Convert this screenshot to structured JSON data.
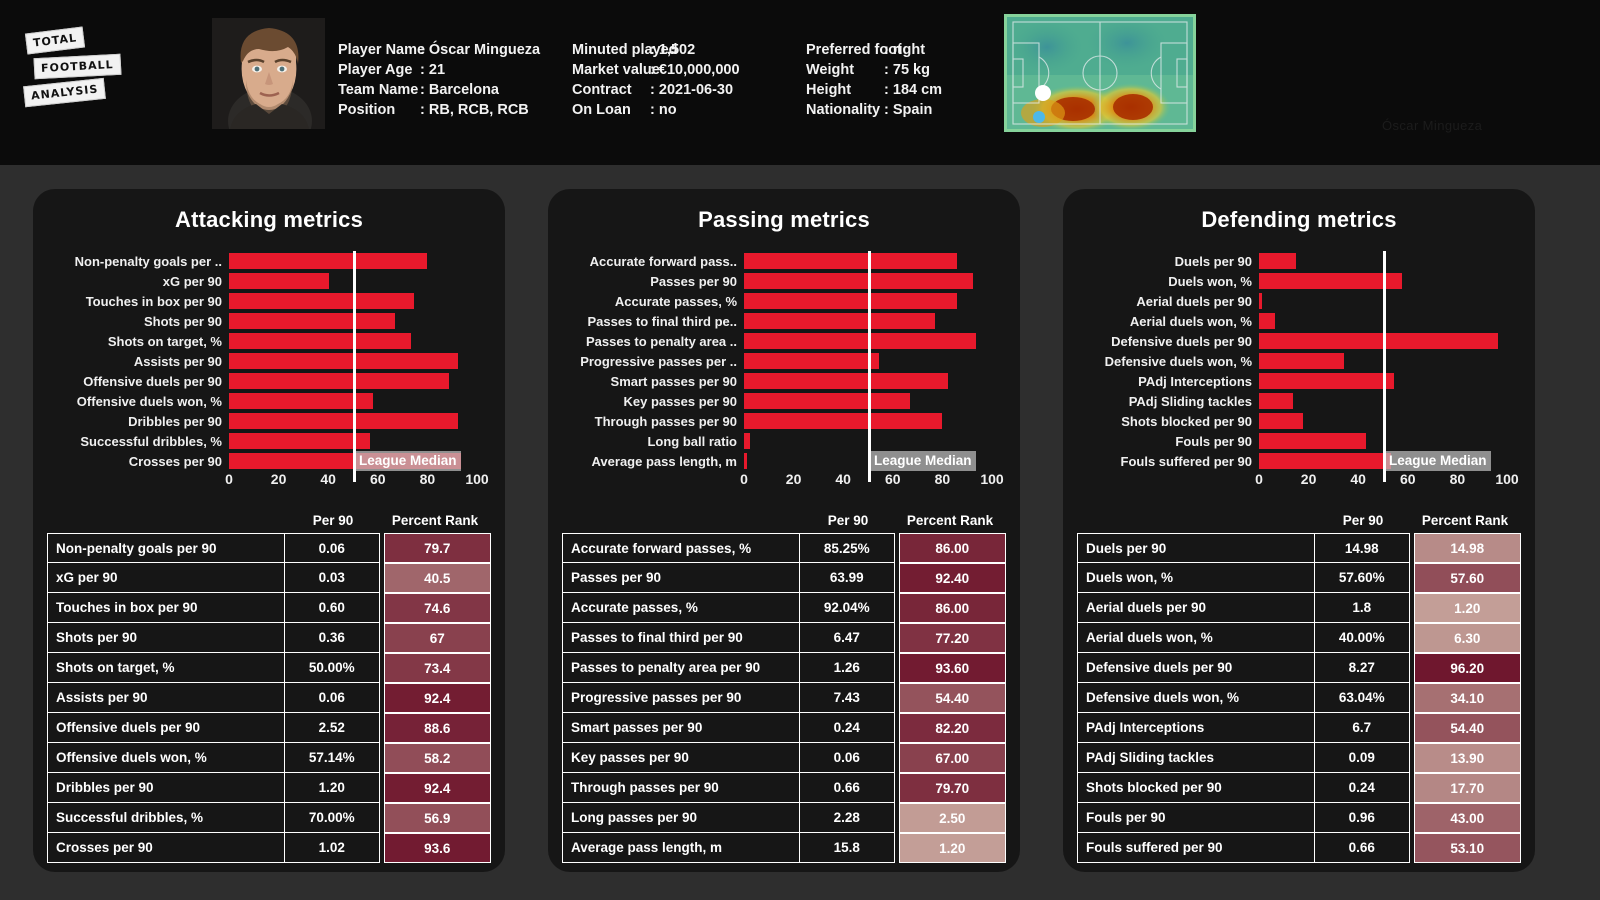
{
  "brand": {
    "line1": "TOTAL",
    "line2": "FOOTBALL",
    "line3": "ANALYSIS"
  },
  "watermark": "Óscar Mingueza",
  "player": {
    "fields_col1": [
      {
        "key": "Player Name",
        "sep": ":",
        "value": "Óscar Mingueza"
      },
      {
        "key": "Player Age",
        "sep": ":",
        "value": "21"
      },
      {
        "key": "Team Name",
        "sep": ":",
        "value": "Barcelona"
      },
      {
        "key": "Position",
        "sep": ":",
        "value": "RB, RCB, RCB"
      }
    ],
    "fields_col2": [
      {
        "key": "Minuted played",
        "sep": ":",
        "value": "1,502"
      },
      {
        "key": "Market value",
        "sep": ":",
        "value": "€10,000,000"
      },
      {
        "key": "Contract",
        "sep": ":",
        "value": "2021-06-30"
      },
      {
        "key": "On Loan",
        "sep": ":",
        "value": "no"
      }
    ],
    "fields_col3": [
      {
        "key": "Preferred foot",
        "sep": ":",
        "value": "right"
      },
      {
        "key": "Weight",
        "sep": ":",
        "value": "75 kg"
      },
      {
        "key": "Height",
        "sep": ":",
        "value": "184 cm"
      },
      {
        "key": "Nationality",
        "sep": ":",
        "value": "Spain"
      }
    ]
  },
  "axis_ticks": [
    "0",
    "20",
    "40",
    "60",
    "80",
    "100"
  ],
  "median_label": "League Median",
  "table_headers": {
    "metric": "",
    "per90": "Per 90",
    "rank": "Percent Rank"
  },
  "accent_bar": "#e8192c",
  "panels": [
    {
      "title": "Attacking metrics",
      "chart_labels": [
        "Non-penalty goals per ..",
        "xG per 90",
        "Touches in box per 90",
        "Shots per 90",
        "Shots on target, %",
        "Assists per 90",
        "Offensive duels per 90",
        "Offensive duels won, %",
        "Dribbles per 90",
        "Successful dribbles, %",
        "Crosses per 90"
      ],
      "rows": [
        {
          "metric": "Non-penalty goals per 90",
          "per90": "0.06",
          "rank": "79.7",
          "rank_value": 79.7
        },
        {
          "metric": "xG per 90",
          "per90": "0.03",
          "rank": "40.5",
          "rank_value": 40.5
        },
        {
          "metric": "Touches in box per 90",
          "per90": "0.60",
          "rank": "74.6",
          "rank_value": 74.6
        },
        {
          "metric": "Shots per 90",
          "per90": "0.36",
          "rank": "67",
          "rank_value": 67.0
        },
        {
          "metric": "Shots on target, %",
          "per90": "50.00%",
          "rank": "73.4",
          "rank_value": 73.4
        },
        {
          "metric": "Assists per 90",
          "per90": "0.06",
          "rank": "92.4",
          "rank_value": 92.4
        },
        {
          "metric": "Offensive duels per 90",
          "per90": "2.52",
          "rank": "88.6",
          "rank_value": 88.6
        },
        {
          "metric": "Offensive duels won, %",
          "per90": "57.14%",
          "rank": "58.2",
          "rank_value": 58.2
        },
        {
          "metric": "Dribbles per 90",
          "per90": "1.20",
          "rank": "92.4",
          "rank_value": 92.4
        },
        {
          "metric": "Successful dribbles, %",
          "per90": "70.00%",
          "rank": "56.9",
          "rank_value": 56.9
        },
        {
          "metric": "Crosses per 90",
          "per90": "1.02",
          "rank": "93.6",
          "rank_value": 93.6
        }
      ]
    },
    {
      "title": "Passing metrics",
      "chart_labels": [
        "Accurate forward pass..",
        "Passes per 90",
        "Accurate passes, %",
        "Passes to final third pe..",
        "Passes to penalty area ..",
        "Progressive passes per ..",
        "Smart passes per 90",
        "Key passes per 90",
        "Through passes per 90",
        "Long ball ratio",
        "Average pass length, m"
      ],
      "rows": [
        {
          "metric": "Accurate forward passes, %",
          "per90": "85.25%",
          "rank": "86.00",
          "rank_value": 86.0
        },
        {
          "metric": "Passes per 90",
          "per90": "63.99",
          "rank": "92.40",
          "rank_value": 92.4
        },
        {
          "metric": "Accurate passes, %",
          "per90": "92.04%",
          "rank": "86.00",
          "rank_value": 86.0
        },
        {
          "metric": "Passes to final third per 90",
          "per90": "6.47",
          "rank": "77.20",
          "rank_value": 77.2
        },
        {
          "metric": "Passes to penalty area per 90",
          "per90": "1.26",
          "rank": "93.60",
          "rank_value": 93.6
        },
        {
          "metric": "Progressive passes per 90",
          "per90": "7.43",
          "rank": "54.40",
          "rank_value": 54.4
        },
        {
          "metric": "Smart passes per 90",
          "per90": "0.24",
          "rank": "82.20",
          "rank_value": 82.2
        },
        {
          "metric": "Key passes per 90",
          "per90": "0.06",
          "rank": "67.00",
          "rank_value": 67.0
        },
        {
          "metric": "Through passes per 90",
          "per90": "0.66",
          "rank": "79.70",
          "rank_value": 79.7
        },
        {
          "metric": "Long passes per 90",
          "per90": "2.28",
          "rank": "2.50",
          "rank_value": 2.5
        },
        {
          "metric": "Average pass length, m",
          "per90": "15.8",
          "rank": "1.20",
          "rank_value": 1.2
        }
      ]
    },
    {
      "title": "Defending metrics",
      "chart_labels": [
        "Duels per 90",
        "Duels won, %",
        "Aerial duels per 90",
        "Aerial duels won, %",
        "Defensive duels per 90",
        "Defensive duels won, %",
        "PAdj Interceptions",
        "PAdj Sliding tackles",
        "Shots blocked per 90",
        "Fouls per 90",
        "Fouls suffered per 90"
      ],
      "rows": [
        {
          "metric": "Duels per 90",
          "per90": "14.98",
          "rank": "14.98",
          "rank_value": 14.98
        },
        {
          "metric": "Duels won, %",
          "per90": "57.60%",
          "rank": "57.60",
          "rank_value": 57.6
        },
        {
          "metric": "Aerial duels per 90",
          "per90": "1.8",
          "rank": "1.20",
          "rank_value": 1.2
        },
        {
          "metric": "Aerial duels won, %",
          "per90": "40.00%",
          "rank": "6.30",
          "rank_value": 6.3
        },
        {
          "metric": "Defensive duels per 90",
          "per90": "8.27",
          "rank": "96.20",
          "rank_value": 96.2
        },
        {
          "metric": "Defensive duels won, %",
          "per90": "63.04%",
          "rank": "34.10",
          "rank_value": 34.1
        },
        {
          "metric": "PAdj Interceptions",
          "per90": "6.7",
          "rank": "54.40",
          "rank_value": 54.4
        },
        {
          "metric": "PAdj Sliding tackles",
          "per90": "0.09",
          "rank": "13.90",
          "rank_value": 13.9
        },
        {
          "metric": "Shots blocked per 90",
          "per90": "0.24",
          "rank": "17.70",
          "rank_value": 17.7
        },
        {
          "metric": "Fouls per 90",
          "per90": "0.96",
          "rank": "43.00",
          "rank_value": 43.0
        },
        {
          "metric": "Fouls suffered per 90",
          "per90": "0.66",
          "rank": "53.10",
          "rank_value": 53.1
        }
      ]
    }
  ],
  "chart_data": [
    {
      "type": "bar",
      "title": "Attacking metrics",
      "xlabel": "",
      "ylabel": "",
      "xlim": [
        0,
        100
      ],
      "categories": [
        "Non-penalty goals per 90",
        "xG per 90",
        "Touches in box per 90",
        "Shots per 90",
        "Shots on target, %",
        "Assists per 90",
        "Offensive duels per 90",
        "Offensive duels won, %",
        "Dribbles per 90",
        "Successful dribbles, %",
        "Crosses per 90"
      ],
      "values": [
        79.7,
        40.5,
        74.6,
        67.0,
        73.4,
        92.4,
        88.6,
        58.2,
        92.4,
        56.9,
        93.6
      ],
      "annotations": [
        {
          "text": "League Median",
          "x": 50
        }
      ],
      "grid": false,
      "legend": null
    },
    {
      "type": "bar",
      "title": "Passing metrics",
      "xlabel": "",
      "ylabel": "",
      "xlim": [
        0,
        100
      ],
      "categories": [
        "Accurate forward passes, %",
        "Passes per 90",
        "Accurate passes, %",
        "Passes to final third per 90",
        "Passes to penalty area per 90",
        "Progressive passes per 90",
        "Smart passes per 90",
        "Key passes per 90",
        "Through passes per 90",
        "Long passes per 90",
        "Average pass length, m"
      ],
      "values": [
        86.0,
        92.4,
        86.0,
        77.2,
        93.6,
        54.4,
        82.2,
        67.0,
        79.7,
        2.5,
        1.2
      ],
      "annotations": [
        {
          "text": "League Median",
          "x": 50
        }
      ],
      "grid": false,
      "legend": null
    },
    {
      "type": "bar",
      "title": "Defending metrics",
      "xlabel": "",
      "ylabel": "",
      "xlim": [
        0,
        100
      ],
      "categories": [
        "Duels per 90",
        "Duels won, %",
        "Aerial duels per 90",
        "Aerial duels won, %",
        "Defensive duels per 90",
        "Defensive duels won, %",
        "PAdj Interceptions",
        "PAdj Sliding tackles",
        "Shots blocked per 90",
        "Fouls per 90",
        "Fouls suffered per 90"
      ],
      "values": [
        14.98,
        57.6,
        1.2,
        6.3,
        96.2,
        34.1,
        54.4,
        13.9,
        17.7,
        43.0,
        53.1
      ],
      "annotations": [
        {
          "text": "League Median",
          "x": 50
        }
      ],
      "grid": false,
      "legend": null
    }
  ]
}
